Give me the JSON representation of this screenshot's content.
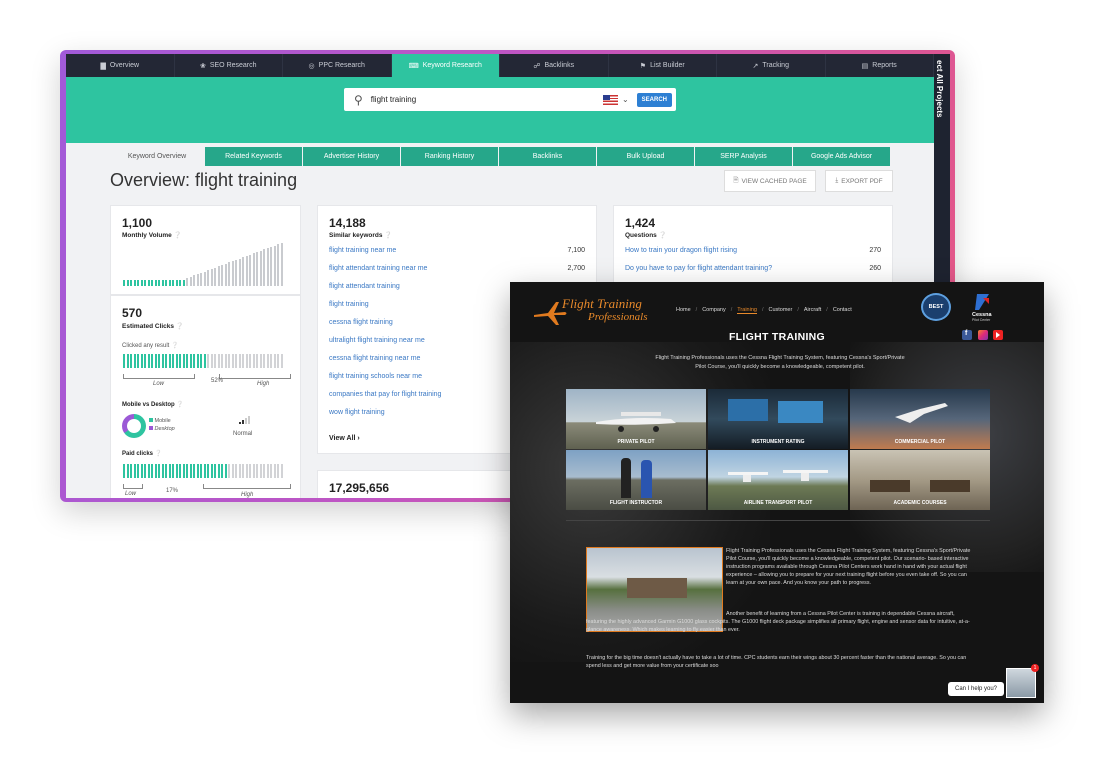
{
  "seo_tool": {
    "top_nav": [
      {
        "icon": "chart-icon",
        "label": "Overview"
      },
      {
        "icon": "leaf-icon",
        "label": "SEO Research"
      },
      {
        "icon": "target-icon",
        "label": "PPC Research"
      },
      {
        "icon": "key-icon",
        "label": "Keyword Research",
        "active": true
      },
      {
        "icon": "link-icon",
        "label": "Backlinks"
      },
      {
        "icon": "list-icon",
        "label": "List Builder"
      },
      {
        "icon": "trend-icon",
        "label": "Tracking"
      },
      {
        "icon": "doc-icon",
        "label": "Reports"
      }
    ],
    "side_label": "ect All Projects",
    "search": {
      "value": "flight training",
      "button": "SEARCH"
    },
    "sub_tabs": [
      {
        "label": "Keyword Overview",
        "active": true
      },
      {
        "label": "Related Keywords"
      },
      {
        "label": "Advertiser History"
      },
      {
        "label": "Ranking History"
      },
      {
        "label": "Backlinks"
      },
      {
        "label": "Bulk Upload"
      },
      {
        "label": "SERP Analysis"
      },
      {
        "label": "Google Ads Advisor"
      }
    ],
    "title": "Overview: flight training",
    "buttons": {
      "cached": "VIEW CACHED PAGE",
      "pdf": "EXPORT PDF"
    },
    "volume": {
      "value": "1,100",
      "label": "Monthly Volume"
    },
    "clicks": {
      "value": "570",
      "label": "Estimated Clicks",
      "clicked_any": "Clicked any result",
      "low": "Low",
      "high": "High",
      "pct": "52%",
      "mvd": "Mobile vs Desktop",
      "mobile": "Mobile",
      "desktop": "Desktop",
      "normal": "Normal",
      "paid": "Paid clicks",
      "paid_low": "Low",
      "paid_pct": "17%",
      "paid_high": "High"
    },
    "similar": {
      "value": "14,188",
      "label": "Similar keywords",
      "items": [
        {
          "k": "flight training near me",
          "v": "7,100"
        },
        {
          "k": "flight attendant training near me",
          "v": "2,700"
        },
        {
          "k": "flight attendant training",
          "v": ""
        },
        {
          "k": "flight training",
          "v": ""
        },
        {
          "k": "cessna flight training",
          "v": ""
        },
        {
          "k": "ultralight flight training near me",
          "v": ""
        },
        {
          "k": "cessna flight training near me",
          "v": ""
        },
        {
          "k": "flight training schools near me",
          "v": ""
        },
        {
          "k": "companies that pay for flight training",
          "v": ""
        },
        {
          "k": "wow flight training",
          "v": ""
        }
      ],
      "view_all": "View All"
    },
    "questions": {
      "value": "1,424",
      "label": "Questions",
      "items": [
        {
          "k": "How to train your dragon flight rising",
          "v": "270"
        },
        {
          "k": "Do you have to pay for flight attendant training?",
          "v": "260"
        }
      ]
    },
    "bottom_card": {
      "value": "17,295,656"
    }
  },
  "site": {
    "logo_line1": "Flight Training",
    "logo_line2": "Professionals",
    "nav": [
      "Home",
      "/",
      "Company",
      "/",
      "Training",
      "/",
      "Customer",
      "/",
      "Aircraft",
      "/",
      "Contact"
    ],
    "badge": "BEST",
    "cessna": "Cessna",
    "cessna_sub": "Pilot Center",
    "heading": "FLIGHT TRAINING",
    "intro": "Flight Training Professionals uses the Cessna Flight Training System, featuring Cessna's Sport/Private Pilot Course, you'll quickly become a knowledgeable, competent pilot.",
    "tiles": [
      "PRIVATE PILOT",
      "INSTRUMENT RATING",
      "COMMERCIAL PILOT",
      "FLIGHT INSTRUCTOR",
      "AIRLINE TRANSPORT PILOT",
      "ACADEMIC COURSES"
    ],
    "p1": "Flight Training Professionals uses the Cessna Flight Training System, featuring Cessna's Sport/Private Pilot Course, you'll quickly become a knowledgeable, competent pilot. Our scenario- based interactive instruction programs available through Cessna Pilot Centers work hand in hand with your actual flight experience – allowing you to prepare for your next training flight before you even take off. So you can learn at your own pace. And you know your path to progress.",
    "p2": "Another benefit of learning from a Cessna Pilot Center is training in dependable Cessna aircraft, featuring the highly advanced Garmin G1000 glass cockpits. The G1000 flight deck package simplifies all primary flight, engine and sensor data for intuitive, at-a-glance awareness. Which makes learning to fly easier than ever.",
    "p3": "Training for the big time doesn't actually have to take a lot of time. CPC students earn their wings about 30 percent faster than the national average. So you can spend less and get more value from your certificate soo",
    "chat": "Can I help you?",
    "chat_badge": "1"
  }
}
